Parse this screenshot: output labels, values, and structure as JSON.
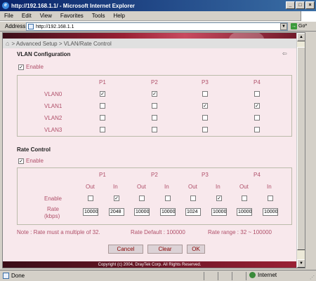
{
  "window": {
    "title": "http://192.168.1.1/ - Microsoft Internet Explorer",
    "buttons": {
      "minimize": "_",
      "maximize": "□",
      "close": "×"
    }
  },
  "menu": {
    "items": [
      "File",
      "Edit",
      "View",
      "Favorites",
      "Tools",
      "Help"
    ]
  },
  "address": {
    "label": "Address",
    "url": "http://192.168.1.1",
    "go": "Go",
    "links": "»"
  },
  "breadcrumb": "> Advanced Setup > VLAN/Rate Control",
  "vlan": {
    "title": "VLAN Configuration",
    "enable_label": "Enable",
    "enabled": true,
    "ports": [
      "P1",
      "P2",
      "P3",
      "P4"
    ],
    "rows": [
      {
        "name": "VLAN0",
        "checks": [
          true,
          true,
          false,
          false
        ]
      },
      {
        "name": "VLAN1",
        "checks": [
          false,
          false,
          true,
          true
        ]
      },
      {
        "name": "VLAN2",
        "checks": [
          false,
          false,
          false,
          false
        ]
      },
      {
        "name": "VLAN3",
        "checks": [
          false,
          false,
          false,
          false
        ]
      }
    ]
  },
  "rate": {
    "title": "Rate Control",
    "enable_label": "Enable",
    "enabled": true,
    "ports": [
      "P1",
      "P2",
      "P3",
      "P4"
    ],
    "sub_headers": [
      "Out",
      "In",
      "Out",
      "In",
      "Out",
      "In",
      "Out",
      "In"
    ],
    "row_enable_label": "Enable",
    "enable_checks": [
      false,
      true,
      false,
      false,
      false,
      true,
      false,
      false
    ],
    "row_rate_label_1": "Rate",
    "row_rate_label_2": "(kbps)",
    "rates": [
      "10000",
      "2048",
      "10000",
      "10000",
      "1024",
      "10000",
      "10000",
      "10000"
    ]
  },
  "notes": {
    "note": "Note :   Rate must a multiple of 32.",
    "default": "Rate Default : 100000",
    "range": "Rate range : 32 ~ 100000"
  },
  "buttons": {
    "cancel": "Cancel",
    "clear": "Clear",
    "ok": "OK"
  },
  "footer": "Copyright (c) 2004, DrayTek Corp. All Rights Reserved.",
  "status": {
    "done": "Done",
    "zone": "Internet"
  }
}
